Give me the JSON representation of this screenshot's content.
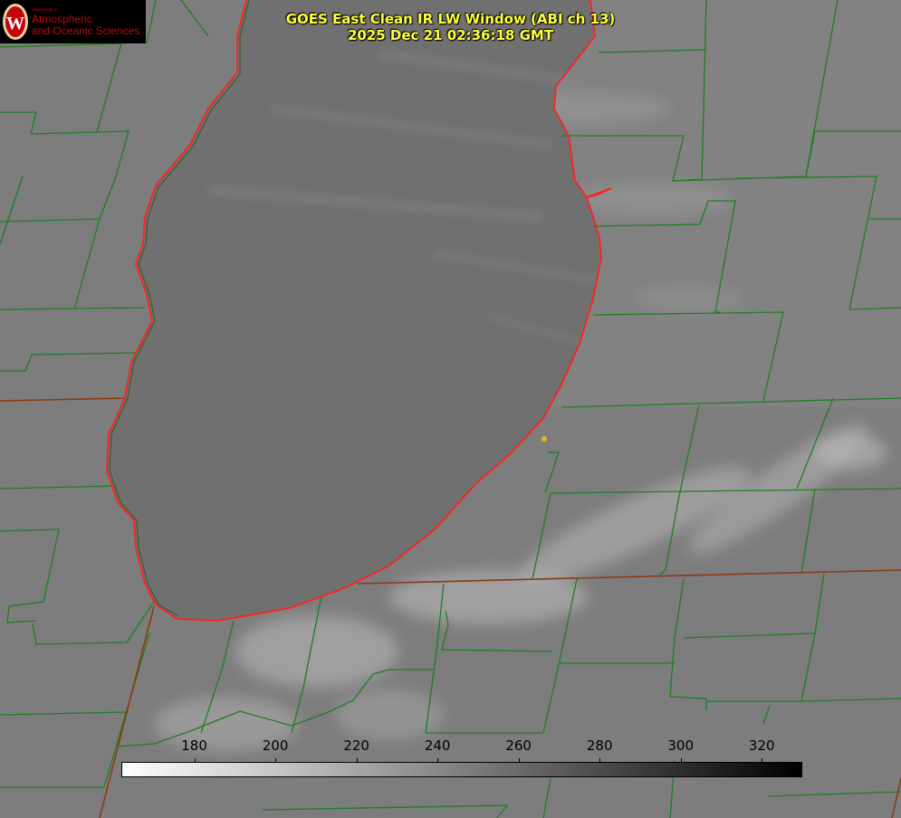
{
  "title": {
    "line1": "GOES East Clean IR LW Window (ABI ch 13)",
    "line2": "2025 Dec 21 02:36:18 GMT"
  },
  "logo": {
    "dept": "Department of",
    "line1": "Atmospheric",
    "line2": "and Oceanic Sciences",
    "seal_letter": "W"
  },
  "colorbar": {
    "min": 162,
    "max": 330,
    "ticks": [
      "180",
      "200",
      "220",
      "240",
      "260",
      "280",
      "300",
      "320"
    ]
  },
  "colors": {
    "county_lines": "#1f7f1f",
    "state_lines": "#8a3a12",
    "coastline": "#ff2020",
    "title": "#ffff3a",
    "logo_red": "#c5050c",
    "station_marker": "#d8c21a",
    "lake_gray": "#707070"
  }
}
